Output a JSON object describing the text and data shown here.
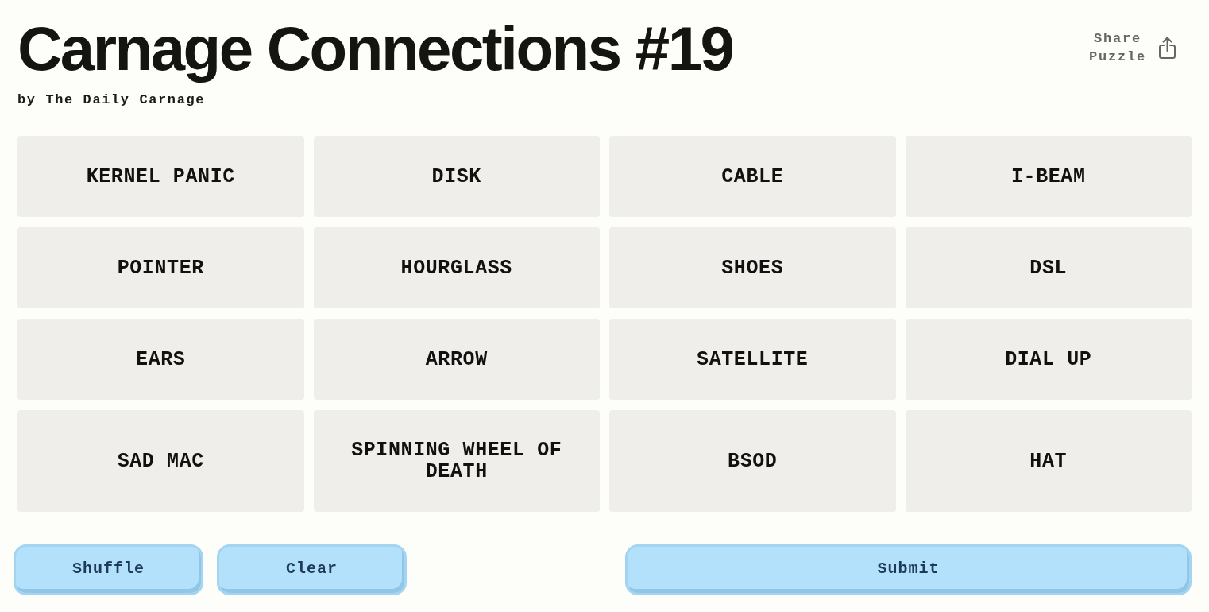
{
  "header": {
    "title": "Carnage Connections #19",
    "byline": "by The Daily Carnage",
    "share_button": {
      "label": "Share Puzzle"
    }
  },
  "tiles": [
    {
      "label": "KERNEL PANIC",
      "selected": false
    },
    {
      "label": "DISK",
      "selected": false
    },
    {
      "label": "CABLE",
      "selected": false
    },
    {
      "label": "I-BEAM",
      "selected": false
    },
    {
      "label": "POINTER",
      "selected": false
    },
    {
      "label": "HOURGLASS",
      "selected": false
    },
    {
      "label": "SHOES",
      "selected": false
    },
    {
      "label": "DSL",
      "selected": false
    },
    {
      "label": "EARS",
      "selected": false
    },
    {
      "label": "ARROW",
      "selected": false
    },
    {
      "label": "SATELLITE",
      "selected": false
    },
    {
      "label": "DIAL UP",
      "selected": false
    },
    {
      "label": "SAD MAC",
      "selected": false
    },
    {
      "label": "SPINNING WHEEL OF DEATH",
      "selected": false
    },
    {
      "label": "BSOD",
      "selected": false
    },
    {
      "label": "HAT",
      "selected": false
    }
  ],
  "actions": {
    "left_buttons": [
      "Shuffle",
      "Clear"
    ],
    "submit_button": "Submit"
  }
}
